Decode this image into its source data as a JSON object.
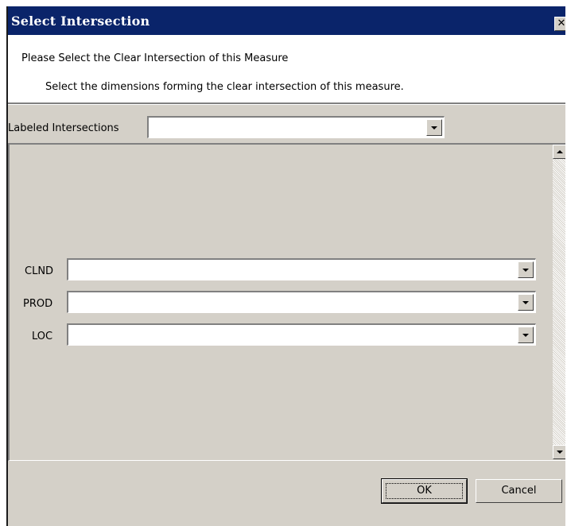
{
  "window": {
    "title": "Select Intersection",
    "close_glyph": "✕"
  },
  "header": {
    "title": "Please Select the Clear Intersection of this Measure",
    "subtitle": "Select the dimensions forming the clear intersection of this measure."
  },
  "labeled_intersections": {
    "label": "Labeled Intersections",
    "value": ""
  },
  "dimensions": [
    {
      "label": "CLND",
      "value": ""
    },
    {
      "label": "PROD",
      "value": ""
    },
    {
      "label": "LOC",
      "value": ""
    }
  ],
  "buttons": {
    "ok_label": "OK",
    "cancel_label": "Cancel"
  },
  "colors": {
    "titlebar": "#0a246a",
    "face": "#d4d0c8"
  }
}
